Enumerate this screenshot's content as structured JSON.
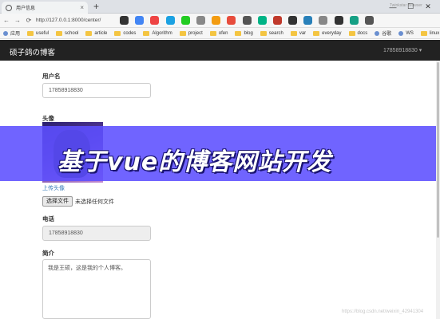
{
  "browser": {
    "tab_title": "用户信息",
    "tab_close": "×",
    "new_tab": "+",
    "url": "http://127.0.0.1:8000/center/",
    "window_buttons": [
      "—",
      "☐",
      "✕"
    ],
    "top_right_label": "Twinkstar Browser",
    "extension_colors": [
      "#333333",
      "#4285f4",
      "#e44",
      "#1ba1e2",
      "#2c2",
      "#888",
      "#f39c12",
      "#e74c3c",
      "#555",
      "#00b386",
      "#c0392b",
      "#333333",
      "#2980b9",
      "#888",
      "#333333",
      "#16a085",
      "#555"
    ]
  },
  "bookmarks": {
    "items": [
      {
        "label": "应用",
        "icon": "apps-icon"
      },
      {
        "label": "useful",
        "icon": "folder-icon"
      },
      {
        "label": "school",
        "icon": "folder-icon"
      },
      {
        "label": "article",
        "icon": "folder-icon"
      },
      {
        "label": "codes",
        "icon": "folder-icon"
      },
      {
        "label": "Algorithm",
        "icon": "folder-icon"
      },
      {
        "label": "project",
        "icon": "folder-icon"
      },
      {
        "label": "ofen",
        "icon": "folder-icon"
      },
      {
        "label": "blog",
        "icon": "folder-icon"
      },
      {
        "label": "search",
        "icon": "folder-icon"
      },
      {
        "label": "var",
        "icon": "folder-icon"
      },
      {
        "label": "everyday",
        "icon": "folder-icon"
      },
      {
        "label": "docs",
        "icon": "folder-icon"
      },
      {
        "label": "谷歌",
        "icon": "google-icon"
      },
      {
        "label": "WS",
        "icon": "ws-icon"
      },
      {
        "label": "linux",
        "icon": "folder-icon"
      }
    ]
  },
  "navbar": {
    "brand": "硕子鸽の博客",
    "user": "17858918830 ▾"
  },
  "form": {
    "username_label": "用户名",
    "username_value": "17858918830",
    "avatar_label": "头像",
    "upload_link": "上传头像",
    "file_button": "选择文件",
    "file_status": "未选择任何文件",
    "phone_label": "电话",
    "phone_value": "17858918830",
    "intro_label": "简介",
    "intro_value": "我是王硕，这是我的个人博客。"
  },
  "banner": {
    "text": "基于vue的博客网站开发",
    "color": "#5c4eff"
  },
  "watermark": "https://blog.csdn.net/weixin_42941304"
}
